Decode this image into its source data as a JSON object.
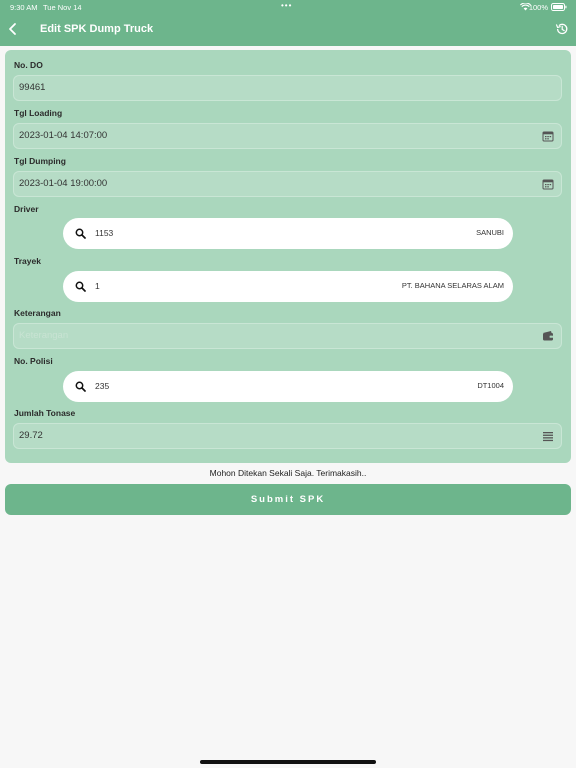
{
  "status_bar": {
    "time": "9:30 AM",
    "date": "Tue Nov 14",
    "dots": "•••",
    "battery": "100%"
  },
  "header": {
    "title": "Edit SPK Dump Truck",
    "color": "#6db58c"
  },
  "form": {
    "no_do": {
      "label": "No. DO",
      "value": "99461"
    },
    "tgl_loading": {
      "label": "Tgl Loading",
      "value": "2023-01-04 14:07:00"
    },
    "tgl_dumping": {
      "label": "Tgl Dumping",
      "value": "2023-01-04 19:00:00"
    },
    "driver": {
      "label": "Driver",
      "code": "1153",
      "name": "SANUBI"
    },
    "trayek": {
      "label": "Trayek",
      "code": "1",
      "name": "PT. BAHANA SELARAS ALAM"
    },
    "keterangan": {
      "label": "Keterangan",
      "placeholder": "Keterangan"
    },
    "no_polisi": {
      "label": "No. Polisi",
      "code": "235",
      "name": "DT1004"
    },
    "jumlah_tonase": {
      "label": "Jumlah Tonase",
      "value": "29.72"
    }
  },
  "note": "Mohon Ditekan Sekali Saja. Terimakasih..",
  "submit_label": "Submit SPK",
  "icons": {
    "back": "chevron-left-icon",
    "history": "history-icon",
    "calendar": "calendar-icon",
    "search": "search-icon",
    "wallet": "wallet-icon",
    "list": "list-icon"
  }
}
